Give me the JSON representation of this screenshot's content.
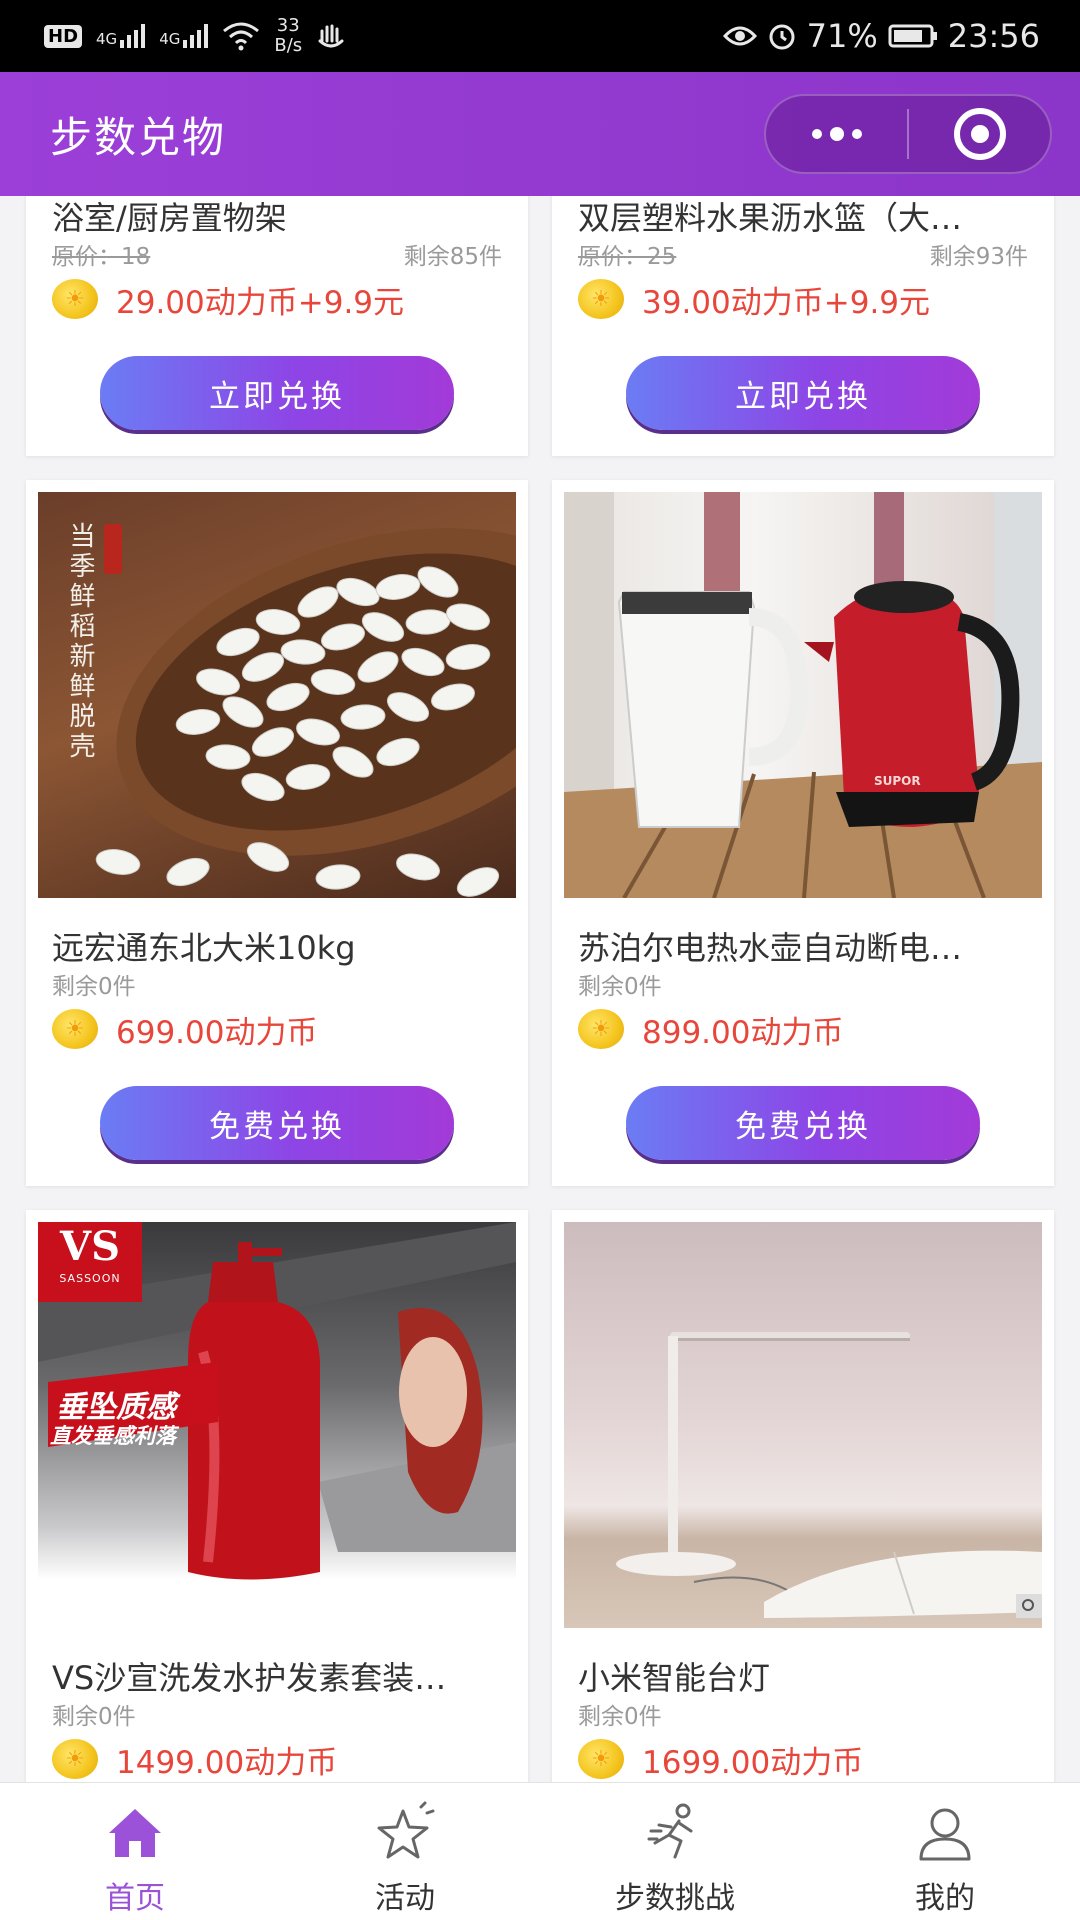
{
  "status_bar": {
    "hd": "HD",
    "net1": "4G",
    "net2": "4G",
    "speed_value": "33",
    "speed_unit": "B/s",
    "battery": "71%",
    "time": "23:56"
  },
  "header": {
    "title": "步数兑物"
  },
  "products": [
    {
      "name": "浴室/厨房置物架",
      "original_price": "原价：18",
      "stock": "剩余85件",
      "price": "29.00动力币+9.9元",
      "button": "立即兑换"
    },
    {
      "name": "双层塑料水果沥水篮（大…",
      "original_price": "原价：25",
      "stock": "剩余93件",
      "price": "39.00动力币+9.9元",
      "button": "立即兑换"
    },
    {
      "name": "远宏通东北大米10kg",
      "stock": "剩余0件",
      "price": "699.00动力币",
      "button": "免费兑换",
      "image_text": [
        "当季鲜稻",
        "新鲜脱壳"
      ]
    },
    {
      "name": "苏泊尔电热水壶自动断电…",
      "stock": "剩余0件",
      "price": "899.00动力币",
      "button": "免费兑换",
      "image_text": [
        "SUPOR"
      ]
    },
    {
      "name": "VS沙宣洗发水护发素套装…",
      "stock": "剩余0件",
      "price": "1499.00动力币",
      "image_text": [
        "VS",
        "SASSOON",
        "垂坠质感",
        "直发垂感利落"
      ]
    },
    {
      "name": "小米智能台灯",
      "stock": "剩余0件",
      "price": "1699.00动力币"
    }
  ],
  "tabs": [
    {
      "label": "首页",
      "icon": "home-icon",
      "active": true
    },
    {
      "label": "活动",
      "icon": "star-icon",
      "active": false
    },
    {
      "label": "步数挑战",
      "icon": "runner-icon",
      "active": false
    },
    {
      "label": "我的",
      "icon": "user-icon",
      "active": false
    }
  ],
  "colors": {
    "accent": "#9b3fd8",
    "price": "#e8463a",
    "tab_active": "#9b52d9"
  }
}
